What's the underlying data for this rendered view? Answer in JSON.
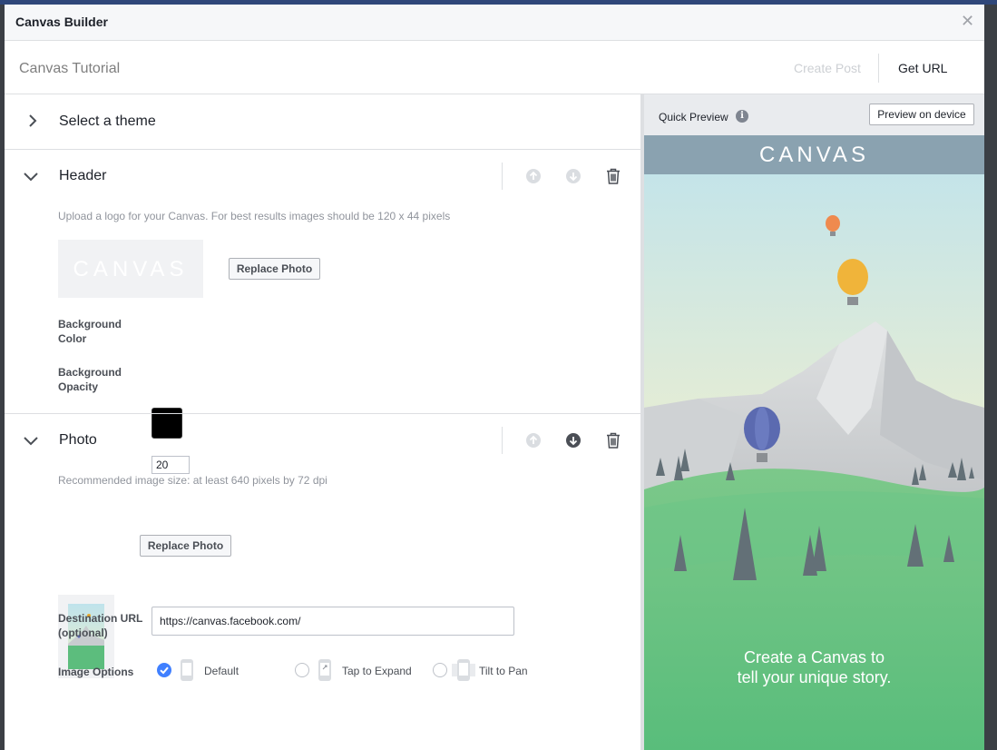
{
  "app": {
    "title": "Canvas Builder",
    "close_icon": "close-icon",
    "close_glyph": "✕"
  },
  "subheader": {
    "title": "Canvas Tutorial",
    "create_post": "Create Post",
    "get_url": "Get URL"
  },
  "theme_section": {
    "title": "Select a theme",
    "icon": "chevron-right-icon"
  },
  "header_section": {
    "title": "Header",
    "hint": "Upload a logo for your Canvas. For best results images should be 120 x 44 pixels",
    "logo_text": "CANVAS",
    "replace_photo": "Replace Photo",
    "bg_color_label": "Background Color",
    "bg_color_value": "#000000",
    "bg_opacity_label": "Background Opacity",
    "bg_opacity_value": "20"
  },
  "photo_section": {
    "title": "Photo",
    "hint": "Recommended image size: at least 640 pixels by 72 dpi",
    "replace_photo": "Replace Photo",
    "dest_url_label": "Destination URL (optional)",
    "dest_url_value": "https://canvas.facebook.com/",
    "image_options_label": "Image Options",
    "options": [
      {
        "label": "Default",
        "selected": true
      },
      {
        "label": "Tap to Expand",
        "selected": false
      },
      {
        "label": "Tilt to Pan",
        "selected": false
      }
    ]
  },
  "preview": {
    "label": "Quick Preview",
    "info_glyph": "i",
    "button": "Preview on device",
    "header_text": "CANVAS",
    "tagline_1": "Create a Canvas to",
    "tagline_2": "tell your unique story."
  },
  "colors": {
    "accent": "#4080ff",
    "frame": "#2f477a",
    "sky_top": "#bfe3ec",
    "sky_bottom": "#eef1c9",
    "grass": "#5cbd7d",
    "mountain": "#c8cccf"
  }
}
